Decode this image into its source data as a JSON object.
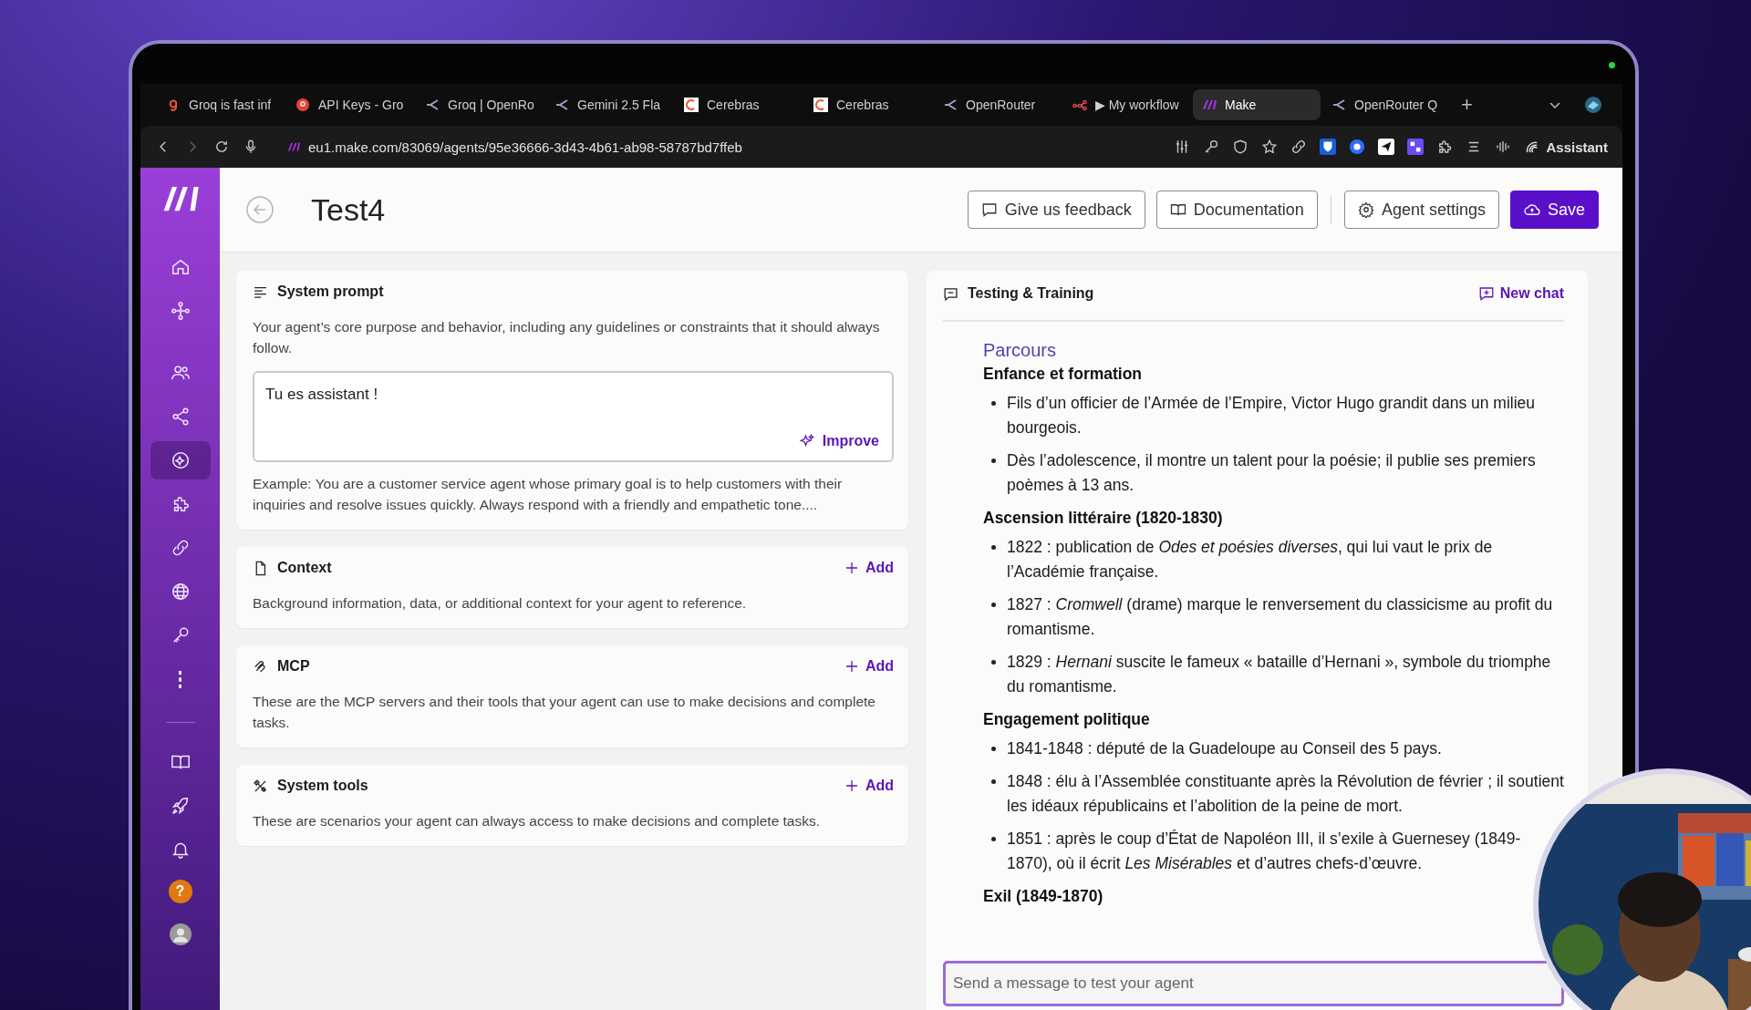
{
  "browser": {
    "tabs": [
      {
        "label": "Groq is fast inf",
        "kind": "groq",
        "selected": false
      },
      {
        "label": "API Keys - Gro",
        "kind": "badge",
        "selected": false
      },
      {
        "label": "Groq | OpenRo",
        "kind": "router",
        "selected": false
      },
      {
        "label": "Gemini 2.5 Fla",
        "kind": "router",
        "selected": false
      },
      {
        "label": "Cerebras",
        "kind": "cerebras",
        "selected": false
      },
      {
        "label": "Cerebras",
        "kind": "cerebras",
        "selected": false
      },
      {
        "label": "OpenRouter",
        "kind": "router",
        "selected": false
      },
      {
        "label": "▶ My workflow",
        "kind": "workflow",
        "selected": false
      },
      {
        "label": "Make",
        "kind": "make",
        "selected": true
      },
      {
        "label": "OpenRouter Q",
        "kind": "router",
        "selected": false
      }
    ],
    "new_tab": "+",
    "url": "eu1.make.com/83069/agents/95e36666-3d43-4b61-ab98-58787bd7ffeb",
    "assistant": "Assistant"
  },
  "sidebar": {
    "items": [
      {
        "kind": "home",
        "selected": false
      },
      {
        "kind": "flow",
        "selected": false
      },
      {
        "kind": "users",
        "selected": false
      },
      {
        "kind": "share",
        "selected": false
      },
      {
        "kind": "agents",
        "selected": true
      },
      {
        "kind": "puzzle",
        "selected": false
      },
      {
        "kind": "link",
        "selected": false
      },
      {
        "kind": "globe",
        "selected": false
      },
      {
        "kind": "key",
        "selected": false
      },
      {
        "kind": "more",
        "selected": false
      }
    ],
    "bottom_items": [
      {
        "kind": "book",
        "selected": false
      },
      {
        "kind": "rocket",
        "selected": false
      },
      {
        "kind": "bell",
        "selected": false
      }
    ],
    "help": "?"
  },
  "header": {
    "title": "Test4",
    "buttons": [
      {
        "label": "Give us feedback",
        "kind": "feedback"
      },
      {
        "label": "Documentation",
        "kind": "docs"
      },
      {
        "label": "Agent settings",
        "kind": "settings"
      },
      {
        "label": "Save",
        "kind": "save"
      }
    ]
  },
  "system_prompt": {
    "title": "System prompt",
    "description": "Your agent’s core purpose and behavior, including any guidelines or constraints that it should always follow.",
    "value": "Tu es assistant !",
    "improve": "Improve",
    "example": "Example: You are a customer service agent whose primary goal is to help customers with their inquiries and resolve issues quickly. Always respond with a friendly and empathetic tone...."
  },
  "sections": [
    {
      "kind": "context",
      "title": "Context",
      "add": "Add",
      "description": "Background information, data, or additional context for your agent to reference."
    },
    {
      "kind": "mcp",
      "title": "MCP",
      "add": "Add",
      "description": "These are the MCP servers and their tools that your agent can use to make decisions and complete tasks."
    },
    {
      "kind": "tools",
      "title": "System tools",
      "add": "Add",
      "description": "These are scenarios your agent can always access to make decisions and complete tasks."
    }
  ],
  "chat": {
    "title": "Testing & Training",
    "new_chat": "New chat",
    "heading": "Parcours",
    "groups": [
      {
        "heading": "Enfance et formation",
        "items": [
          "Fils d’un officier de l’Armée de l’Empire, Victor Hugo grandit dans un milieu bourgeois.",
          "Dès l’adolescence, il montre un talent pour la poésie; il publie ses premiers poèmes à 13 ans."
        ]
      },
      {
        "heading": "Ascension littéraire (1820-1830)",
        "items": [
          "1822 : publication de *Odes et poésies diverses*, qui lui vaut le prix de l’Académie française.",
          "1827 : *Cromwell* (drame) marque le renversement du classicisme au profit du romantisme.",
          "1829 : *Hernani* suscite le fameux « bataille d’Hernani », symbole du triomphe du romantisme."
        ]
      },
      {
        "heading": "Engagement politique",
        "items": [
          "1841-1848 : député de la Guadeloupe au Conseil des 5 pays.",
          "1848 : élu à l’Assemblée constituante après la Révolution de février ; il soutient les idéaux républicains et l’abolition de la peine de mort.",
          "1851 : après le coup d’État de Napoléon III, il s’exile à Guernesey (1849-1870), où il écrit *Les Misérables* et d’autres chefs-d’œuvre."
        ]
      },
      {
        "heading": "Exil (1849-1870)"
      }
    ],
    "placeholder": "Send a message to test your agent"
  }
}
